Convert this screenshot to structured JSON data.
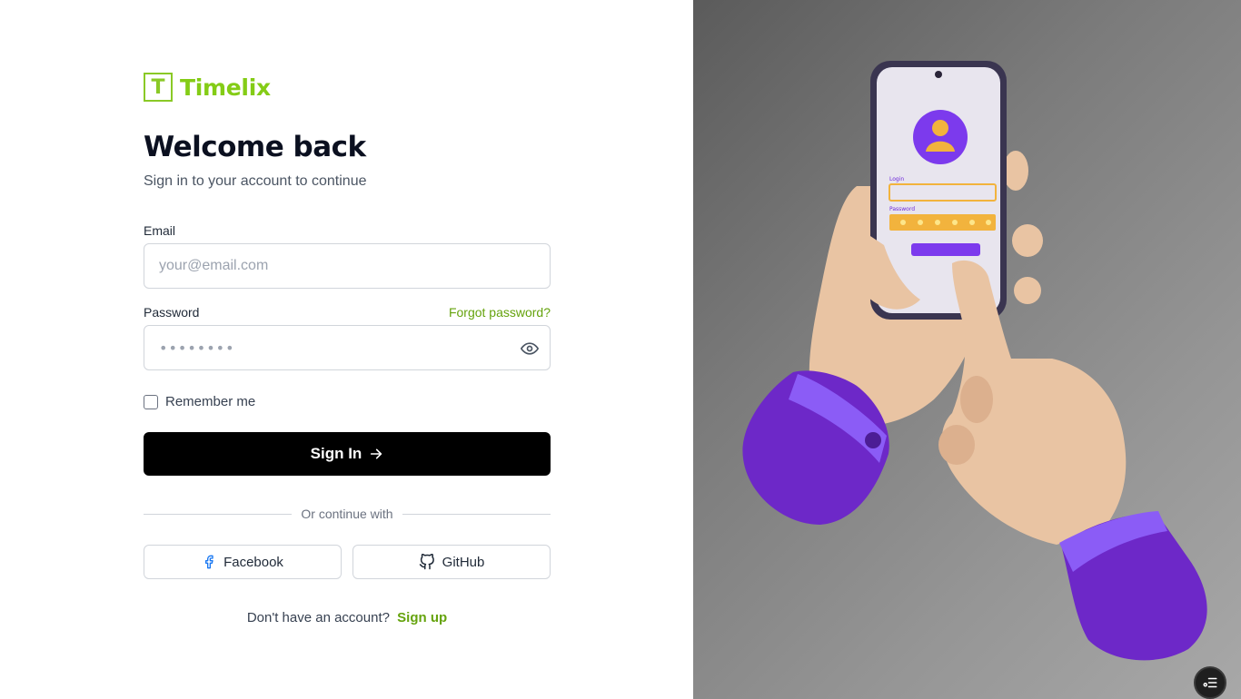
{
  "brand": {
    "mark": "T",
    "name": "Timelix",
    "color": "#84cc16"
  },
  "heading": {
    "title": "Welcome back",
    "subtitle": "Sign in to your account to continue"
  },
  "email": {
    "label": "Email",
    "placeholder": "your@email.com",
    "value": ""
  },
  "password": {
    "label": "Password",
    "placeholder": "••••••••",
    "value": "",
    "forgot_label": "Forgot password?",
    "toggle_icon": "eye-icon"
  },
  "remember": {
    "label": "Remember me",
    "checked": false
  },
  "signin": {
    "label": "Sign In",
    "icon": "arrow-right-icon",
    "background": "#000000"
  },
  "divider": {
    "label": "Or continue with"
  },
  "social": [
    {
      "label": "Facebook",
      "icon": "facebook-icon"
    },
    {
      "label": "GitHub",
      "icon": "github-icon"
    }
  ],
  "signup": {
    "prompt": "Don't have an account?",
    "link_label": "Sign up"
  },
  "illustration": {
    "name": "hands-with-phone-login-illustration",
    "phone_texts": {
      "login": "Login",
      "password": "Password"
    },
    "accent_color": "#7c3aed",
    "field_color": "#f2b33d"
  },
  "floating_button": {
    "icon": "tasks-icon"
  }
}
